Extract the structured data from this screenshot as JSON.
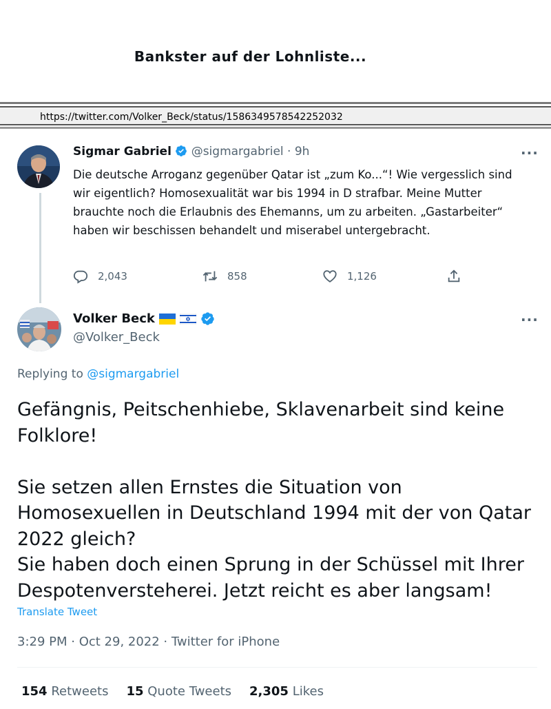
{
  "page": {
    "title": "Bankster auf der Lohnliste...",
    "url": "https://twitter.com/Volker_Beck/status/1586349578542252032"
  },
  "tweet1": {
    "name": "Sigmar Gabriel",
    "handle": "@sigmargabriel",
    "time": "· 9h",
    "more": "···",
    "body": "Die deutsche Arroganz gegenüber Qatar ist „zum Ko...“! Wie vergesslich sind wir eigentlich? Homosexualität war bis 1994 in D strafbar. Meine Mutter brauchte noch die Erlaubnis des Ehemanns, um zu arbeiten. „Gastarbeiter“ haben wir beschissen behandelt und miserabel untergebracht.",
    "replies": "2,043",
    "retweets": "858",
    "likes": "1,126"
  },
  "tweet2": {
    "name": "Volker Beck",
    "handle": "@Volker_Beck",
    "more": "···",
    "replying_prefix": "Replying to ",
    "replying_to": "@sigmargabriel",
    "body_p1": "Gefängnis, Peitschenhiebe, Sklavenarbeit sind keine Folklore!",
    "body_p2": "Sie setzen allen Ernstes die Situation von Homosexuellen in Deutschland 1994 mit der von Qatar 2022 gleich?",
    "body_p3": "Sie haben doch einen Sprung in der Schüssel mit Ihrer Despotenversteherei. Jetzt reicht es aber langsam!",
    "translate": "Translate Tweet",
    "meta": "3:29 PM · Oct 29, 2022 · Twitter for iPhone",
    "stats": {
      "retweets_count": "154",
      "retweets_label": "Retweets",
      "quotes_count": "15",
      "quotes_label": "Quote Tweets",
      "likes_count": "2,305",
      "likes_label": "Likes"
    }
  },
  "colors": {
    "link": "#1d9bf0",
    "muted": "#536471",
    "text": "#0f1419",
    "thread_line": "#cfd9de"
  }
}
